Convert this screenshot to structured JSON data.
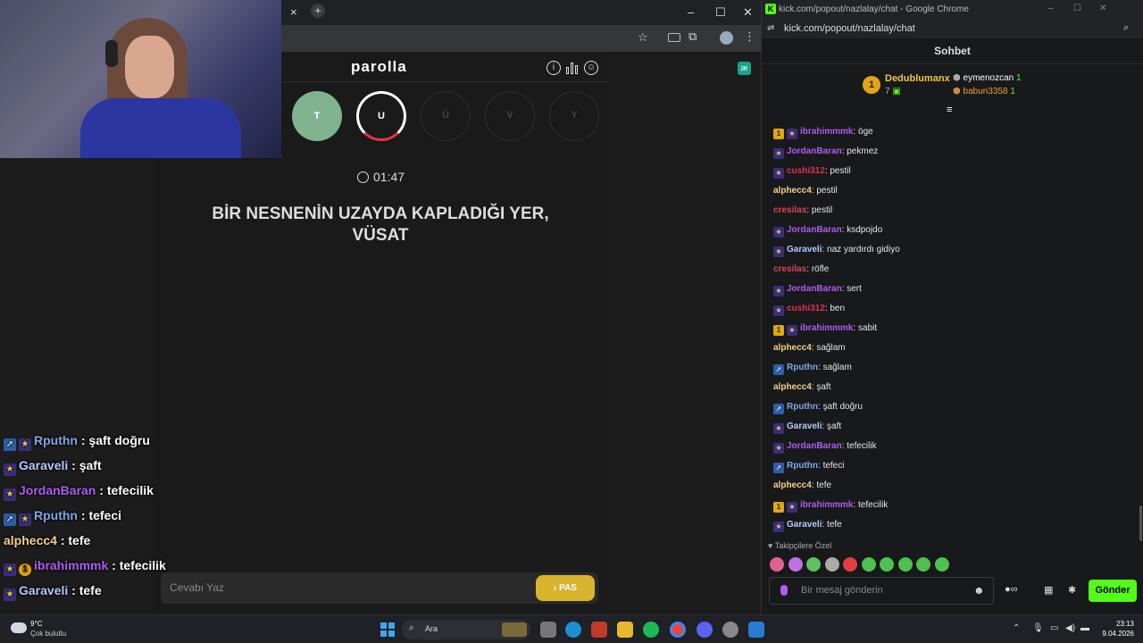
{
  "browser": {
    "tab_close": "×",
    "new_tab": "+",
    "controls": [
      "–",
      "☐",
      "✕"
    ]
  },
  "game": {
    "title": "parolla",
    "letters": [
      {
        "char": "T",
        "state": "correct"
      },
      {
        "char": "U",
        "state": "active"
      },
      {
        "char": "Ü",
        "state": "pending"
      },
      {
        "char": "V",
        "state": "pending"
      },
      {
        "char": "Y",
        "state": "pending"
      }
    ],
    "timer": "01:47",
    "question": "BİR NESNENİN UZAYDA KAPLADIĞI YER, VÜSAT",
    "answer_placeholder": "Cevabı Yaz",
    "pass_label": "PAS"
  },
  "overlay_chat": [
    {
      "badges": [
        "prime",
        "star"
      ],
      "user": "Rputhn",
      "text": "şaft doğru",
      "color": "#7fa7e6"
    },
    {
      "badges": [
        "star"
      ],
      "user": "Garaveli",
      "text": "şaft",
      "color": "#b6c8ff"
    },
    {
      "badges": [
        "star"
      ],
      "user": "JordanBaran",
      "text": "tefecilik",
      "color": "#b05cf2"
    },
    {
      "badges": [
        "prime",
        "star"
      ],
      "user": "Rputhn",
      "text": "tefeci",
      "color": "#7fa7e6"
    },
    {
      "badges": [],
      "user": "alphecc4",
      "text": "tefe",
      "color": "#f2d28a"
    },
    {
      "badges": [
        "star",
        "one"
      ],
      "user": "ibrahimmmk",
      "text": "tefecilik",
      "color": "#b05cf2"
    },
    {
      "badges": [
        "star"
      ],
      "user": "Garaveli",
      "text": "tefe",
      "color": "#b6c8ff"
    }
  ],
  "chat_window": {
    "title": "kick.com/popout/nazlalay/chat - Google Chrome",
    "url": "kick.com/popout/nazlalay/chat",
    "header": "Sohbet",
    "leaderboard": {
      "first": {
        "rank": "1",
        "user": "Dedublumanx",
        "count": "7"
      },
      "others": [
        {
          "user": "eymenozcan",
          "count": "1"
        },
        {
          "user": "babun3358",
          "count": "1"
        }
      ]
    },
    "messages": [
      {
        "badges": [
          "one",
          "star"
        ],
        "user": "ibrahimmmk",
        "text": "öge",
        "color": "#b05cf2"
      },
      {
        "badges": [
          "star"
        ],
        "user": "JordanBaran",
        "text": "pekmez",
        "color": "#b05cf2"
      },
      {
        "badges": [
          "star"
        ],
        "user": "cushi312",
        "text": "pestil",
        "color": "#e0324f"
      },
      {
        "badges": [],
        "user": "alphecc4",
        "text": "pestil",
        "color": "#f2d28a"
      },
      {
        "badges": [],
        "user": "cresilas",
        "text": "pestil",
        "color": "#e04060"
      },
      {
        "badges": [
          "star"
        ],
        "user": "JordanBaran",
        "text": "ksdpojdo",
        "color": "#b05cf2"
      },
      {
        "badges": [
          "star"
        ],
        "user": "Garaveli",
        "text": "naz yardırdı gidiyo",
        "color": "#b6c8ff"
      },
      {
        "badges": [],
        "user": "cresilas",
        "text": "röfle",
        "color": "#e04060"
      },
      {
        "badges": [
          "star"
        ],
        "user": "JordanBaran",
        "text": "sert",
        "color": "#b05cf2"
      },
      {
        "badges": [
          "star"
        ],
        "user": "cushi312",
        "text": "ben",
        "color": "#e0324f"
      },
      {
        "badges": [
          "one",
          "star"
        ],
        "user": "ibrahimmmk",
        "text": "sabit",
        "color": "#b05cf2"
      },
      {
        "badges": [],
        "user": "alphecc4",
        "text": "sağlam",
        "color": "#f2d28a"
      },
      {
        "badges": [
          "prime"
        ],
        "user": "Rputhn",
        "text": "sağlam",
        "color": "#7fa7e6"
      },
      {
        "badges": [],
        "user": "alphecc4",
        "text": "şaft",
        "color": "#f2d28a"
      },
      {
        "badges": [
          "prime"
        ],
        "user": "Rputhn",
        "text": "şaft doğru",
        "color": "#7fa7e6"
      },
      {
        "badges": [
          "star"
        ],
        "user": "Garaveli",
        "text": "şaft",
        "color": "#b6c8ff"
      },
      {
        "badges": [
          "star"
        ],
        "user": "JordanBaran",
        "text": "tefecilik",
        "color": "#b05cf2"
      },
      {
        "badges": [
          "prime"
        ],
        "user": "Rputhn",
        "text": "tefeci",
        "color": "#7fa7e6"
      },
      {
        "badges": [],
        "user": "alphecc4",
        "text": "tefe",
        "color": "#f2d28a"
      },
      {
        "badges": [
          "one",
          "star"
        ],
        "user": "ibrahimmmk",
        "text": "tefecilik",
        "color": "#b05cf2"
      },
      {
        "badges": [
          "star"
        ],
        "user": "Garaveli",
        "text": "tefe",
        "color": "#b6c8ff"
      }
    ],
    "followers_only": "Takipçilere Özel",
    "input_placeholder": "Bir mesaj gönderin",
    "send_label": "Gönder"
  },
  "taskbar": {
    "weather_temp": "9°C",
    "weather_desc": "Çok bulutlu",
    "search_label": "Ara",
    "time": "23:13",
    "date": "9.04.2026"
  },
  "colors": {
    "accent_green": "#53fc18",
    "pass_yellow": "#d8b52d",
    "correct_green": "#7fb48f"
  }
}
